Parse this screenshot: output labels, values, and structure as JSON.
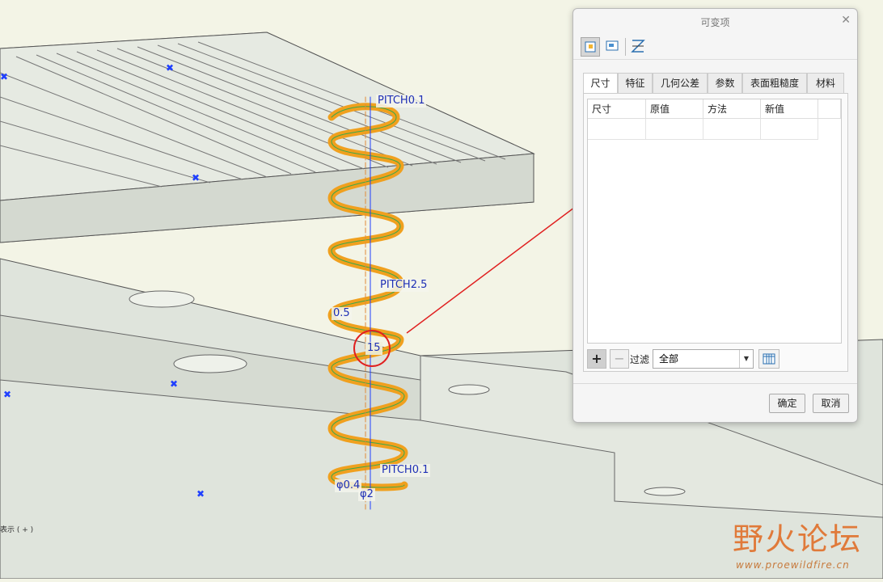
{
  "viewport": {
    "annotations": {
      "pitch_top": "PITCH0.1",
      "pitch_mid": "PITCH2.5",
      "dim_mid": "0.5",
      "dim_center": "15",
      "pitch_bottom": "PITCH0.1",
      "dia_bottom": "φ0.4",
      "dia_bottom2": "φ2"
    },
    "status_text": "表示 ( + )",
    "watermark": {
      "title": "野火论坛",
      "url": "www.proewildfire.cn"
    }
  },
  "dialog": {
    "title": "可变项",
    "close_icon": "close-icon",
    "toolbar": [
      {
        "name": "dimension-mode-icon",
        "active": true
      },
      {
        "name": "feature-mode-icon",
        "active": false
      },
      {
        "name": "pattern-mode-icon",
        "active": false
      }
    ],
    "tabs": [
      "尺寸",
      "特征",
      "几何公差",
      "参数",
      "表面粗糙度",
      "材料"
    ],
    "active_tab": "尺寸",
    "table": {
      "columns": [
        "尺寸",
        "原值",
        "方法",
        "新值"
      ],
      "rows": []
    },
    "add_label": "+",
    "remove_label": "−",
    "filter_label": "过滤",
    "filter_value": "全部",
    "table_config_icon": "table-columns-icon",
    "ok_label": "确定",
    "cancel_label": "取消"
  },
  "colors": {
    "background": "#f3f4e6",
    "part_face": "#dfe4dc",
    "spring": "#f0a01e",
    "dimension_text": "#1e2fb5",
    "highlight": "#e02020"
  }
}
